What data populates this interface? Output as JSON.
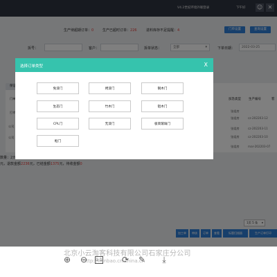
{
  "topbar": {
    "version": "V4.2世纪环境外联登录",
    "user": "下午好",
    "icons": [
      "user-icon",
      "close-icon"
    ]
  },
  "stats": {
    "produce_label": "生产待超期订单：",
    "produce_count": "0",
    "overdue_label": "生产已超时订单：",
    "overdue_count": "226",
    "stock_label": "进料库存不足提醒：",
    "stock_count": "4"
  },
  "toolbar": {
    "btn1": "门单设置",
    "btn2": "查询设置"
  },
  "filters": {
    "order_no_label": "拆号：",
    "customer_label": "客户：",
    "status_label": "拆单状态：",
    "status_value": "全部",
    "date_label": "下单日期：",
    "date_value": "2022-03-25"
  },
  "table": {
    "side_button": "保证",
    "headers": [
      "加急类型",
      "生产编号",
      "客"
    ],
    "rows": [
      {
        "a": "",
        "b": "",
        "c": "",
        "d": "张姐房",
        "e": "",
        "f": ""
      },
      {
        "a": "打孝",
        "b": "",
        "c": "",
        "d": "张姐房",
        "e": "cz-202203-12",
        "f": ""
      },
      {
        "a": "",
        "b": "",
        "c": "",
        "d": "张姐房",
        "e": "cz-202203-11",
        "f": ""
      },
      {
        "a": "",
        "b": "",
        "c": "",
        "d": "张姐房",
        "e": "cz-202203-10",
        "f": ""
      },
      {
        "a": "",
        "b": "",
        "c": "",
        "d": "张姐房",
        "e": "mar-202203-07",
        "f": ""
      }
    ],
    "sidecol": [
      "门单",
      "打孝",
      "公司",
      "公司"
    ]
  },
  "bottom_text": {
    "line1": "数量：",
    "line2": "2",
    "line3": "元，已收",
    "line4": "元，退款金额",
    "line5": "元，已结金额",
    "sum1": "1",
    "sum2": "2236",
    "sum3": "1375",
    "sum4": "0",
    "tail": "元，待收金额"
  },
  "pager": {
    "value": "1页 5 条",
    "chevron": "▾"
  },
  "bottom_buttons": [
    "加工单",
    "审核",
    "订单",
    "查看",
    "标题扫描器",
    "生产订单打印"
  ],
  "modal": {
    "title": "选择订单类型",
    "close": "X",
    "buttons": [
      "免漆门",
      "烤漆门",
      "钢木门",
      "生态门",
      "竹木门",
      "铝木门",
      "CPL门",
      "无漆门",
      "极简玻璃门",
      "框门"
    ]
  },
  "viewer": {
    "icons": [
      "zoom-in-icon",
      "zoom-out-icon",
      "fit-icon",
      "rotate-icon",
      "pen-icon",
      "download-icon"
    ],
    "fit_label": "1:1"
  },
  "watermark": {
    "line1": "北京小云淘客科技有限公司石家庄分公司",
    "line2": "http://lianbao.cn.china.cn"
  }
}
